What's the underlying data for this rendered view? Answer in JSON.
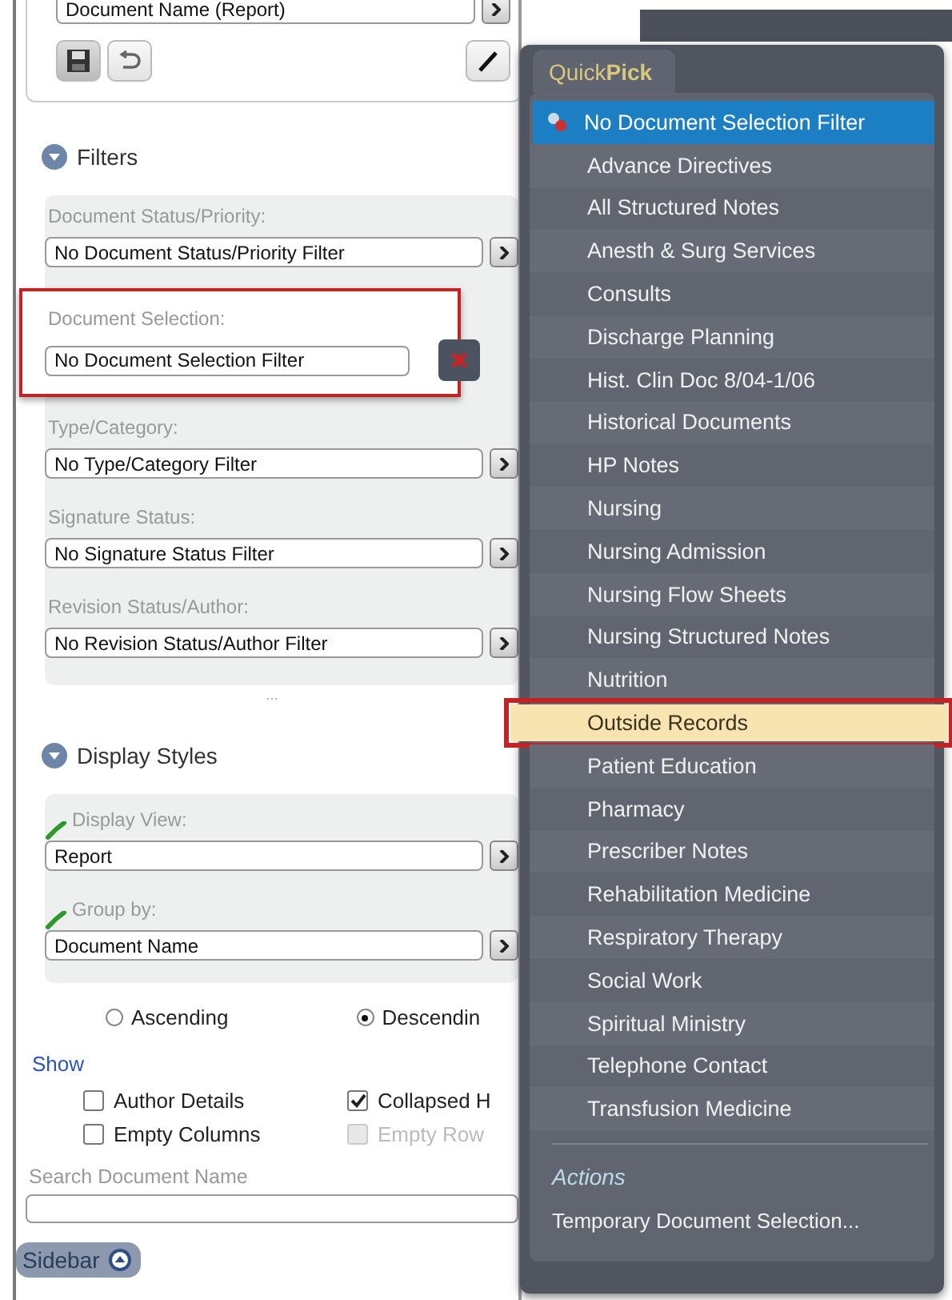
{
  "top_field": {
    "value": "Document Name (Report)"
  },
  "filters": {
    "title": "Filters",
    "expanded": true,
    "groups": [
      {
        "label": "Document Status/Priority:",
        "value": "No Document Status/Priority Filter",
        "outlined": false,
        "clearable": false
      },
      {
        "label": "Document Selection:",
        "value": "No Document Selection Filter",
        "outlined": true,
        "clearable": true
      },
      {
        "label": "Type/Category:",
        "value": "No Type/Category Filter",
        "outlined": false,
        "clearable": false
      },
      {
        "label": "Signature Status:",
        "value": "No Signature Status Filter",
        "outlined": false,
        "clearable": false
      },
      {
        "label": "Revision Status/Author:",
        "value": "No Revision Status/Author Filter",
        "outlined": false,
        "clearable": false
      }
    ]
  },
  "splitter": "...",
  "display_styles": {
    "title": "Display Styles",
    "expanded": true,
    "groups": [
      {
        "label": "Display View:",
        "value": "Report",
        "linked": true
      },
      {
        "label": "Group by:",
        "value": "Document Name",
        "linked": true
      }
    ]
  },
  "sort": [
    {
      "label": "Ascending",
      "selected": false
    },
    {
      "label": "Descendin",
      "selected": true
    }
  ],
  "show": {
    "title": "Show",
    "options": [
      {
        "label": "Author Details",
        "checked": false,
        "disabled": false
      },
      {
        "label": "Collapsed H",
        "checked": true,
        "disabled": false
      },
      {
        "label": "Empty Columns",
        "checked": false,
        "disabled": false
      },
      {
        "label": "Empty Row",
        "checked": false,
        "disabled": true
      }
    ]
  },
  "search": {
    "label": "Search Document Name"
  },
  "sidebar_button": "Sidebar",
  "quickpick": {
    "tab": "Quick**Pick**",
    "items": [
      {
        "label": "No Document Selection Filter",
        "selected": true,
        "highlighted": false,
        "outlined": false
      },
      {
        "label": "Advance Directives",
        "selected": false,
        "highlighted": false,
        "outlined": false
      },
      {
        "label": "All Structured Notes",
        "selected": false,
        "highlighted": false,
        "outlined": false
      },
      {
        "label": "Anesth & Surg Services",
        "selected": false,
        "highlighted": false,
        "outlined": false
      },
      {
        "label": "Consults",
        "selected": false,
        "highlighted": false,
        "outlined": false
      },
      {
        "label": "Discharge Planning",
        "selected": false,
        "highlighted": false,
        "outlined": false
      },
      {
        "label": "Hist. Clin Doc 8/04-1/06",
        "selected": false,
        "highlighted": false,
        "outlined": false
      },
      {
        "label": "Historical Documents",
        "selected": false,
        "highlighted": false,
        "outlined": false
      },
      {
        "label": "HP Notes",
        "selected": false,
        "highlighted": false,
        "outlined": false
      },
      {
        "label": "Nursing",
        "selected": false,
        "highlighted": false,
        "outlined": false
      },
      {
        "label": "Nursing Admission",
        "selected": false,
        "highlighted": false,
        "outlined": false
      },
      {
        "label": "Nursing Flow Sheets",
        "selected": false,
        "highlighted": false,
        "outlined": false
      },
      {
        "label": "Nursing Structured Notes",
        "selected": false,
        "highlighted": false,
        "outlined": false
      },
      {
        "label": "Nutrition",
        "selected": false,
        "highlighted": false,
        "outlined": false
      },
      {
        "label": "Outside Records",
        "selected": false,
        "highlighted": true,
        "outlined": true
      },
      {
        "label": "Patient Education",
        "selected": false,
        "highlighted": false,
        "outlined": false
      },
      {
        "label": "Pharmacy",
        "selected": false,
        "highlighted": false,
        "outlined": false
      },
      {
        "label": "Prescriber Notes",
        "selected": false,
        "highlighted": false,
        "outlined": false
      },
      {
        "label": "Rehabilitation Medicine",
        "selected": false,
        "highlighted": false,
        "outlined": false
      },
      {
        "label": "Respiratory Therapy",
        "selected": false,
        "highlighted": false,
        "outlined": false
      },
      {
        "label": "Social Work",
        "selected": false,
        "highlighted": false,
        "outlined": false
      },
      {
        "label": "Spiritual Ministry",
        "selected": false,
        "highlighted": false,
        "outlined": false
      },
      {
        "label": "Telephone Contact",
        "selected": false,
        "highlighted": false,
        "outlined": false
      },
      {
        "label": "Transfusion Medicine",
        "selected": false,
        "highlighted": false,
        "outlined": false
      }
    ],
    "actions_title": "Actions",
    "actions": [
      "Temporary Document Selection..."
    ]
  }
}
